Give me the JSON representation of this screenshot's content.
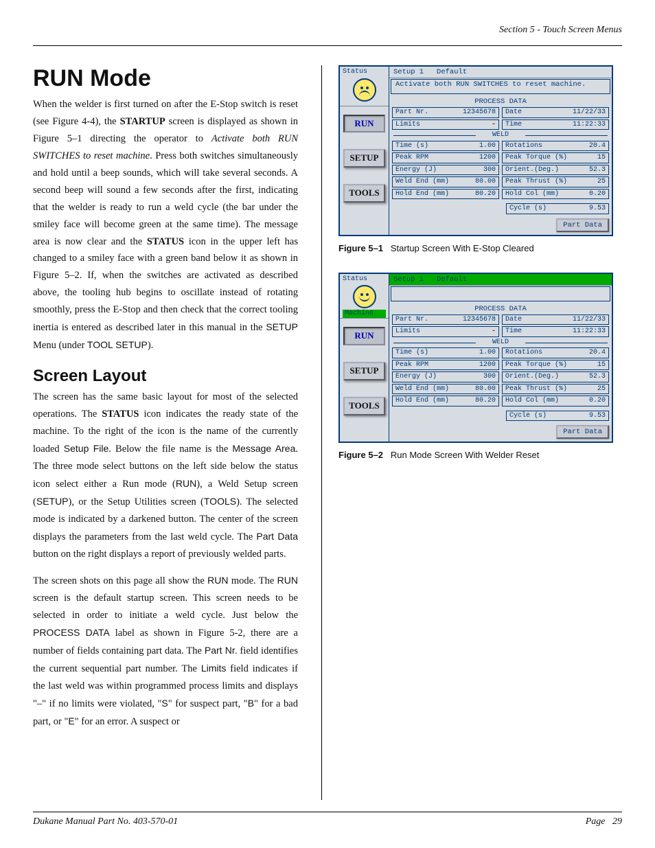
{
  "header": {
    "section": "Section 5 - Touch Screen Menus"
  },
  "h1": "RUN Mode",
  "h2": "Screen Layout",
  "footer": {
    "left": "Dukane Manual Part No. 403-570-01",
    "right_label": "Page",
    "right_num": "29"
  },
  "p1a": "When the welder is first turned on after the E-Stop switch is reset (see Figure 4-4), the ",
  "p1b": "STARTUP",
  "p1c": " screen is displayed as shown in Figure 5–1 directing the operator to ",
  "p1d": "Activate both RUN SWITCHES to reset machine",
  "p1e": ". Press both switches simultaneously and hold until a beep sounds, which will take several seconds. A second beep will sound a few seconds after the first, indicating that the welder is ready to run a weld cycle (the bar under the smiley face will become green at the same time). The message area is now clear and the ",
  "p1f": "STATUS",
  "p1g": " icon in the upper left has changed to a smiley face with a green band below it as shown in Figure 5–2. If, when the switches are activated as described above, the tooling hub begins to oscillate instead of rotating smoothly, press the E-Stop and then check that the correct tooling inertia is entered as described later in this manual in the ",
  "p1h": "SETUP",
  "p1i": " Menu (under ",
  "p1j": "TOOL SETUP",
  "p1k": ").",
  "p2a": "The screen has the same basic layout  for most of the selected operations. The ",
  "p2b": "STATUS",
  "p2c": " icon indicates the ready state of the machine. To the right of the icon is the name of the currently loaded ",
  "p2d": "Setup File",
  "p2e": ". Below the file name is the ",
  "p2f": "Message Area",
  "p2g": ". The three mode select buttons on the left side below the status icon select either a Run mode (",
  "p2h": "RUN",
  "p2i": "), a Weld Setup screen (",
  "p2j": "SETUP",
  "p2k": "), or the Setup Utilities screen (",
  "p2l": "TOOLS",
  "p2m": "). The selected mode is indicated by a darkened button. The center of the screen displays the parameters from the last weld cycle. The ",
  "p2n": "Part Data",
  "p2o": " button on the right displays a report of previously welded parts.",
  "p3a": "The screen shots on this page all show the ",
  "p3b": "RUN",
  "p3c": " mode. The ",
  "p3d": "RUN",
  "p3e": " screen is the default startup screen. This screen needs to be selected in order to initiate a weld cycle. Just below the ",
  "p3f": "PROCESS DATA",
  "p3g": " label as shown in Figure 5-2, there are a number of fields containing part data. The ",
  "p3h": "Part Nr.",
  "p3i": " field identifies the current sequential part number. The ",
  "p3j": "Limits",
  "p3k": " field indicates if the last weld was within programmed process limits and displays \"–\" if no limits were violated, \"",
  "p3l": "S",
  "p3m": "\" for suspect part, \"",
  "p3n": "B",
  "p3o": "\" for a bad part, or \"",
  "p3p": "E",
  "p3q": "\" for an error. A suspect or",
  "fig1": {
    "status_label": "Status",
    "setup_file": "Setup 1",
    "default": "Default",
    "message": "Activate both RUN SWITCHES to reset machine.",
    "process_data": "PROCESS DATA",
    "weld_label": "WELD",
    "run_btn": "RUN",
    "setup_btn": "SETUP",
    "tools_btn": "TOOLS",
    "part_data_btn": "Part Data",
    "fields": {
      "part_nr": {
        "l": "Part Nr.",
        "v": "12345678"
      },
      "date": {
        "l": "Date",
        "v": "11/22/33"
      },
      "limits": {
        "l": "Limits",
        "v": "-"
      },
      "time": {
        "l": "Time",
        "v": "11:22:33"
      },
      "time_s": {
        "l": "Time (s)",
        "v": "1.00"
      },
      "rot": {
        "l": "Rotations",
        "v": "20.4"
      },
      "rpm": {
        "l": "Peak RPM",
        "v": "1200"
      },
      "torque": {
        "l": "Peak Torque (%)",
        "v": "15"
      },
      "energy": {
        "l": "Energy (J)",
        "v": "300"
      },
      "orient": {
        "l": "Orient.(Deg.)",
        "v": "52.3"
      },
      "weldend": {
        "l": "Weld End (mm)",
        "v": "80.00"
      },
      "thrust": {
        "l": "Peak Thrust (%)",
        "v": "25"
      },
      "holdend": {
        "l": "Hold End (mm)",
        "v": "80.20"
      },
      "holdcol": {
        "l": "Hold Col (mm)",
        "v": "0.20"
      },
      "cycle": {
        "l": "Cycle (s)",
        "v": "9.53"
      }
    },
    "caption_b": "Figure 5–1",
    "caption": "Startup Screen With E-Stop Cleared"
  },
  "fig2": {
    "status_label": "Status",
    "machine": "Machine",
    "setup_file": "Setup 1",
    "default": "Default",
    "process_data": "PROCESS DATA",
    "weld_label": "WELD",
    "run_btn": "RUN",
    "setup_btn": "SETUP",
    "tools_btn": "TOOLS",
    "part_data_btn": "Part Data",
    "fields": {
      "part_nr": {
        "l": "Part Nr.",
        "v": "12345678"
      },
      "date": {
        "l": "Date",
        "v": "11/22/33"
      },
      "limits": {
        "l": "Limits",
        "v": "-"
      },
      "time": {
        "l": "Time",
        "v": "11:22:33"
      },
      "time_s": {
        "l": "Time (s)",
        "v": "1.00"
      },
      "rot": {
        "l": "Rotations",
        "v": "20.4"
      },
      "rpm": {
        "l": "Peak RPM",
        "v": "1200"
      },
      "torque": {
        "l": "Peak Torque (%)",
        "v": "15"
      },
      "energy": {
        "l": "Energy (J)",
        "v": "300"
      },
      "orient": {
        "l": "Orient.(Deg.)",
        "v": "52.3"
      },
      "weldend": {
        "l": "Weld End (mm)",
        "v": "80.00"
      },
      "thrust": {
        "l": "Peak Thrust (%)",
        "v": "25"
      },
      "holdend": {
        "l": "Hold End (mm)",
        "v": "80.20"
      },
      "holdcol": {
        "l": "Hold Col (mm)",
        "v": "0.20"
      },
      "cycle": {
        "l": "Cycle (s)",
        "v": "9.53"
      }
    },
    "caption_b": "Figure 5–2",
    "caption": "Run Mode Screen With Welder Reset"
  }
}
